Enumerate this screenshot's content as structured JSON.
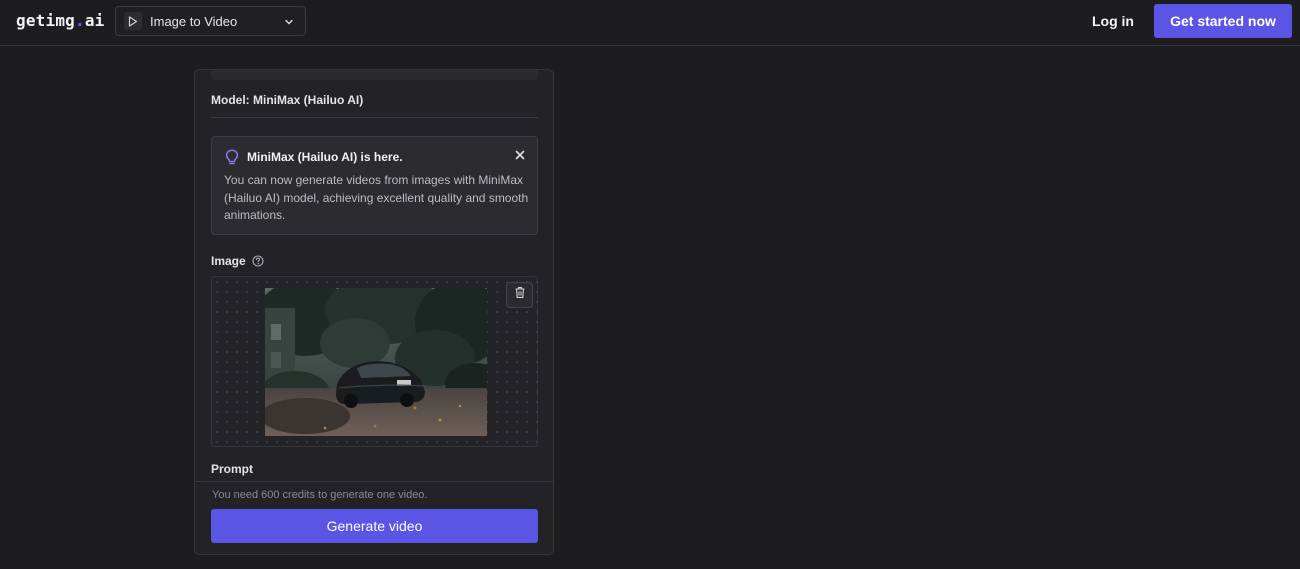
{
  "header": {
    "logo_main": "getimg",
    "logo_dot": ".",
    "logo_tld": "ai",
    "tool_selector": {
      "label": "Image to Video",
      "icon": "play-icon"
    },
    "login_label": "Log in",
    "cta_label": "Get started now"
  },
  "panel": {
    "model_line": "Model: MiniMax (Hailuo AI)",
    "notice": {
      "title": "MiniMax (Hailuo AI) is here.",
      "body": "You can now generate videos from images with MiniMax (Hailuo AI) model, achieving excellent quality and smooth animations.",
      "icon": "lightbulb-icon"
    },
    "image_label": "Image",
    "prompt_label": "Prompt",
    "credits_note": "You need 600 credits to generate one video.",
    "generate_label": "Generate video"
  },
  "colors": {
    "accent": "#5b55e6",
    "background": "#1d1d20",
    "panel": "#232327"
  }
}
